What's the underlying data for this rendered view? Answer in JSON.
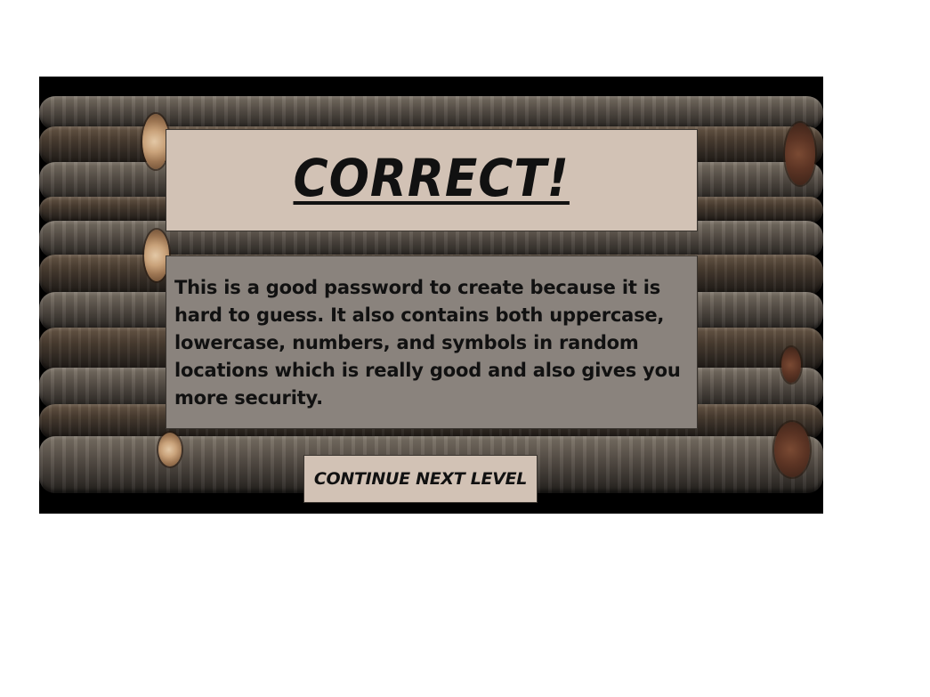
{
  "result": {
    "heading": "CORRECT!",
    "explanation": "This is a good password to create because it is hard to guess. It also contains both uppercase, lowercase, numbers, and symbols in random locations which is really good and also gives you more security."
  },
  "actions": {
    "continue_label": "CONTINUE NEXT LEVEL"
  },
  "theme": {
    "panel_light": "#d2c2b5",
    "panel_dark": "#8a837d",
    "text": "#111111",
    "letterbox": "#000000"
  }
}
